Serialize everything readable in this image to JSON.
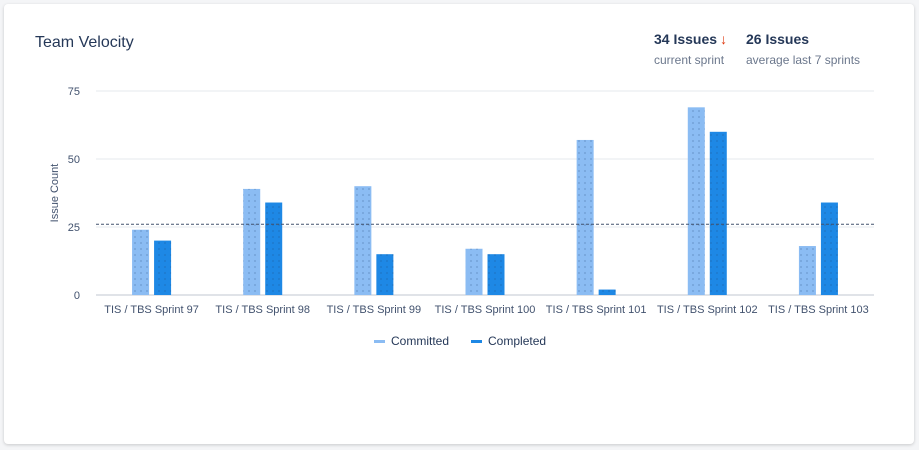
{
  "header": {
    "title": "Team Velocity",
    "current": {
      "value": "34 Issues",
      "arrow": "↓",
      "label": "current sprint"
    },
    "average": {
      "value": "26 Issues",
      "label": "average last 7 sprints"
    }
  },
  "colors": {
    "committed": "#8bbcf3",
    "completed": "#1e88e5",
    "average_line": "#42526e"
  },
  "chart_data": {
    "type": "bar",
    "title": "Team Velocity",
    "xlabel": "",
    "ylabel": "Issue Count",
    "ylim": [
      0,
      75
    ],
    "yticks": [
      0,
      25,
      50,
      75
    ],
    "grid": true,
    "legend": "bottom",
    "categories": [
      "TIS / TBS Sprint 97",
      "TIS / TBS Sprint 98",
      "TIS / TBS Sprint 99",
      "TIS / TBS Sprint 100",
      "TIS / TBS Sprint 101",
      "TIS / TBS Sprint 102",
      "TIS / TBS Sprint 103"
    ],
    "series": [
      {
        "name": "Committed",
        "values": [
          24,
          39,
          40,
          17,
          57,
          69,
          18
        ]
      },
      {
        "name": "Completed",
        "values": [
          20,
          34,
          15,
          15,
          2,
          60,
          34
        ]
      }
    ],
    "reference_line": {
      "value": 26,
      "style": "dashed"
    }
  }
}
